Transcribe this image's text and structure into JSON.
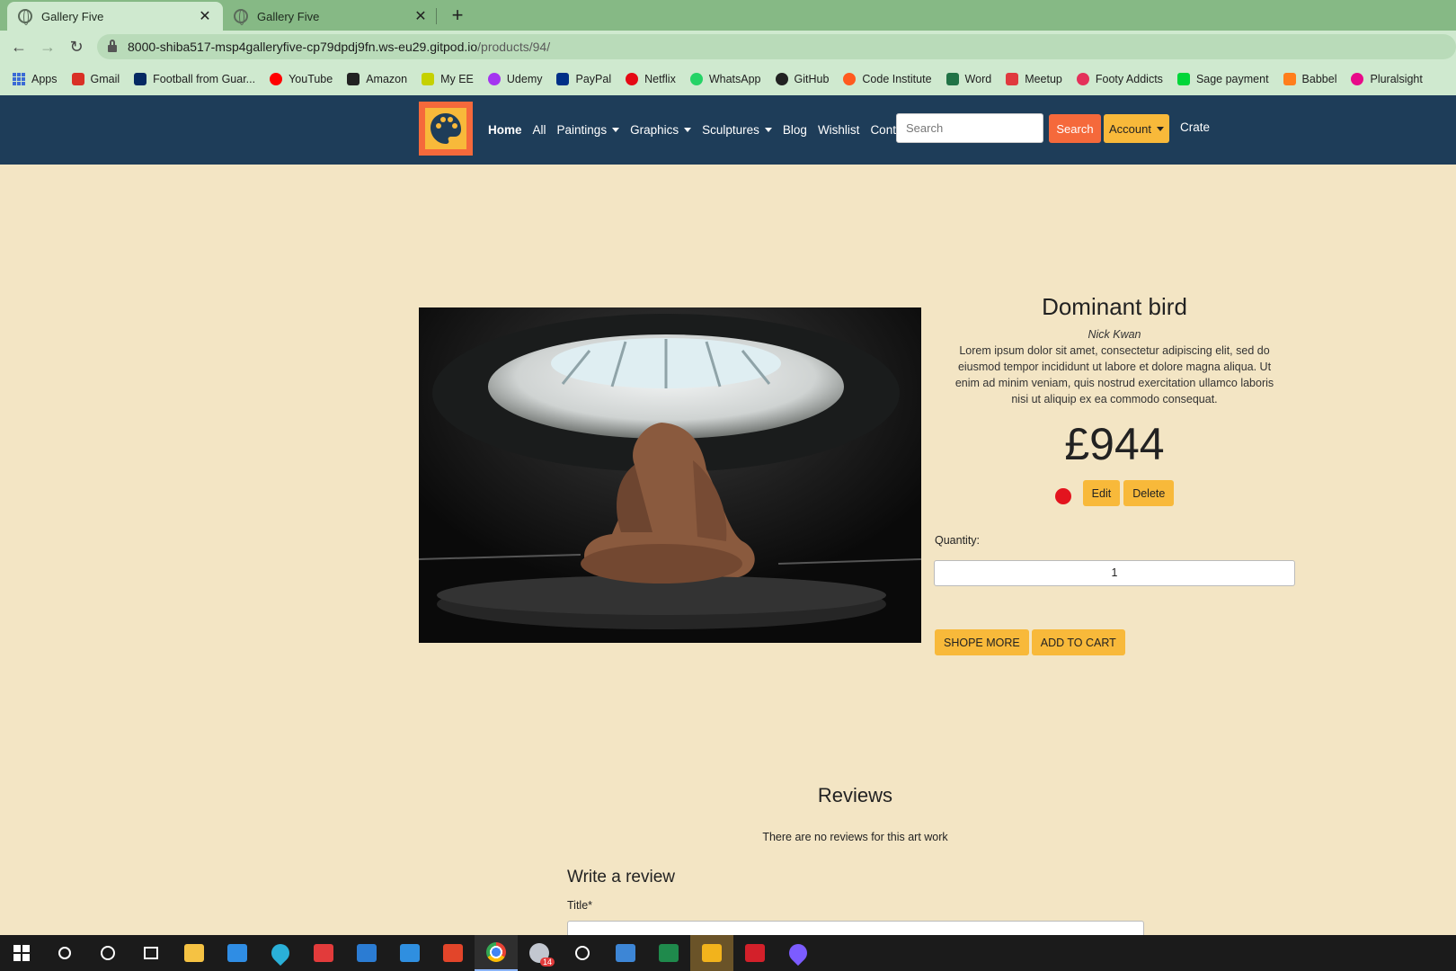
{
  "browser": {
    "tabs": [
      {
        "title": "Gallery Five",
        "active": true
      },
      {
        "title": "Gallery Five",
        "active": false
      }
    ],
    "url_host": "8000-shiba517-msp4galleryfive-cp79dpdj9fn.ws-eu29.gitpod.io",
    "url_path": "/products/94/",
    "bookmarks": [
      {
        "label": "Apps",
        "icon": "apps-grid-icon",
        "color": "#3b6bd6"
      },
      {
        "label": "Gmail",
        "icon": "gmail-icon",
        "color": "#d93025"
      },
      {
        "label": "Football from Guar...",
        "icon": "guardian-icon",
        "color": "#052962"
      },
      {
        "label": "YouTube",
        "icon": "youtube-icon",
        "color": "#ff0000"
      },
      {
        "label": "Amazon",
        "icon": "amazon-icon",
        "color": "#222222"
      },
      {
        "label": "My EE",
        "icon": "ee-icon",
        "color": "#c5d100"
      },
      {
        "label": "Udemy",
        "icon": "udemy-icon",
        "color": "#a435f0"
      },
      {
        "label": "PayPal",
        "icon": "paypal-icon",
        "color": "#003087"
      },
      {
        "label": "Netflix",
        "icon": "netflix-icon",
        "color": "#e50914"
      },
      {
        "label": "WhatsApp",
        "icon": "whatsapp-icon",
        "color": "#25d366"
      },
      {
        "label": "GitHub",
        "icon": "github-icon",
        "color": "#222222"
      },
      {
        "label": "Code Institute",
        "icon": "code-institute-icon",
        "color": "#ff5a1f"
      },
      {
        "label": "Word",
        "icon": "word-icon",
        "color": "#217346"
      },
      {
        "label": "Meetup",
        "icon": "meetup-icon",
        "color": "#e0393e"
      },
      {
        "label": "Footy Addicts",
        "icon": "footy-addicts-icon",
        "color": "#e4315a"
      },
      {
        "label": "Sage payment",
        "icon": "sage-icon",
        "color": "#00d639"
      },
      {
        "label": "Babbel",
        "icon": "babbel-icon",
        "color": "#ff7e1c"
      },
      {
        "label": "Pluralsight",
        "icon": "pluralsight-icon",
        "color": "#e80a89"
      }
    ]
  },
  "nav": {
    "links": [
      "Home",
      "All",
      "Paintings",
      "Graphics",
      "Sculptures",
      "Blog",
      "Wishlist",
      "Contact"
    ],
    "dropdowns": [
      "Paintings",
      "Graphics",
      "Sculptures"
    ],
    "search_placeholder": "Search",
    "search_button": "Search",
    "account_button": "Account",
    "crate_link": "Crate",
    "colors": {
      "navbar": "#1e3d59",
      "accent_orange": "#f5693b",
      "accent_yellow": "#f8b93a",
      "page_bg": "#f3e5c4"
    }
  },
  "product": {
    "title": "Dominant bird",
    "artist": "Nick Kwan",
    "description": "Lorem ipsum dolor sit amet, consectetur adipiscing elit, sed do eiusmod tempor incididunt ut labore et dolore magna aliqua. Ut enim ad minim veniam, quis nostrud exercitation ullamco laboris nisi ut aliquip ex ea commodo consequat.",
    "price": "£944",
    "status_color": "#e3141e",
    "edit_label": "Edit",
    "delete_label": "Delete",
    "quantity_label": "Quantity:",
    "quantity_value": "1",
    "shop_more_label": "SHOPE MORE",
    "add_to_cart_label": "ADD TO CART"
  },
  "reviews": {
    "heading": "Reviews",
    "empty_text": "There are no reviews for this art work",
    "form_heading": "Write a review",
    "title_label": "Title*"
  },
  "taskbar": {
    "apps": [
      "windows-start-icon",
      "search-icon",
      "cortana-icon",
      "task-view-icon",
      "file-explorer-icon",
      "store-icon",
      "edge-icon",
      "gift-icon",
      "mail-icon",
      "vscode-icon",
      "office-icon",
      "chrome-icon",
      "slack-icon",
      "emoji-icon",
      "photos-icon",
      "excel-icon",
      "security-icon",
      "mcafee-icon",
      "paint-drop-icon"
    ],
    "badge_count": "14"
  }
}
